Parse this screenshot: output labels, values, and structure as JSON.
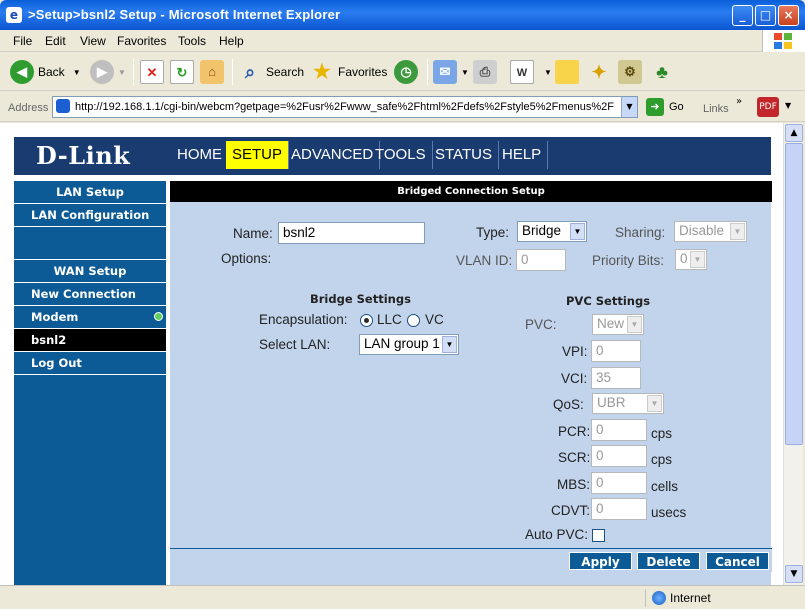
{
  "window": {
    "title": ">Setup>bsnl2 Setup - Microsoft Internet Explorer",
    "min": "_",
    "max": "□",
    "close": "×"
  },
  "menu": [
    "File",
    "Edit",
    "View",
    "Favorites",
    "Tools",
    "Help"
  ],
  "toolbar": {
    "back": "Back",
    "search": "Search",
    "favorites": "Favorites"
  },
  "address": {
    "label": "Address",
    "url": "http://192.168.1.1/cgi-bin/webcm?getpage=%2Fusr%2Fwww_safe%2Fhtml%2Fdefs%2Fstyle5%2Fmenus%2F",
    "go": "Go",
    "links": "Links"
  },
  "status": {
    "zone": "Internet"
  },
  "app": {
    "logo": "D-Link",
    "nav": [
      "HOME",
      "SETUP",
      "ADVANCED",
      "TOOLS",
      "STATUS",
      "HELP"
    ],
    "active_nav": "SETUP",
    "sidebar": {
      "lan_setup": "LAN Setup",
      "lan_config": "LAN Configuration",
      "wan_setup": "WAN Setup",
      "new_connection": "New Connection",
      "modem": "Modem",
      "bsnl2": "bsnl2",
      "logout": "Log Out"
    },
    "section_title": "Bridged Connection Setup",
    "form": {
      "name_label": "Name:",
      "name_value": "bsnl2",
      "type_label": "Type:",
      "type_value": "Bridge",
      "sharing_label": "Sharing:",
      "sharing_value": "Disable",
      "options_label": "Options:",
      "vlan_label": "VLAN ID:",
      "vlan_value": "0",
      "priority_label": "Priority Bits:",
      "priority_value": "0"
    },
    "bridge": {
      "title": "Bridge Settings",
      "encap_label": "Encapsulation:",
      "llc": "LLC",
      "vc": "VC",
      "encap_selected": "LLC",
      "lan_label": "Select LAN:",
      "lan_value": "LAN group 1"
    },
    "pvc": {
      "title": "PVC Settings",
      "pvc_label": "PVC:",
      "pvc_value": "New",
      "vpi_label": "VPI:",
      "vpi_value": "0",
      "vci_label": "VCI:",
      "vci_value": "35",
      "qos_label": "QoS:",
      "qos_value": "UBR",
      "pcr_label": "PCR:",
      "pcr_value": "0",
      "pcr_unit": "cps",
      "scr_label": "SCR:",
      "scr_value": "0",
      "scr_unit": "cps",
      "mbs_label": "MBS:",
      "mbs_value": "0",
      "mbs_unit": "cells",
      "cdvt_label": "CDVT:",
      "cdvt_value": "0",
      "cdvt_unit": "usecs",
      "autopvc_label": "Auto PVC:"
    },
    "buttons": {
      "apply": "Apply",
      "delete": "Delete",
      "cancel": "Cancel"
    }
  }
}
